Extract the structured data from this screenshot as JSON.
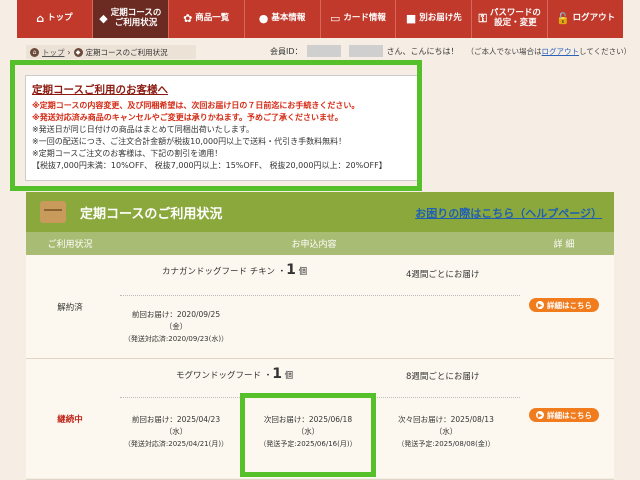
{
  "nav": [
    {
      "icon": "⌂",
      "label": "トップ",
      "active": false
    },
    {
      "icon": "◆",
      "label": "定期コースの\nご利用状況",
      "active": true
    },
    {
      "icon": "✿",
      "label": "商品一覧",
      "active": false
    },
    {
      "icon": "●",
      "label": "基本情報",
      "active": false
    },
    {
      "icon": "▭",
      "label": "カード情報",
      "active": false
    },
    {
      "icon": "■",
      "label": "別お届け先",
      "active": false
    },
    {
      "icon": "⚿",
      "label": "パスワードの\n設定・変更",
      "active": false
    },
    {
      "icon": "🔓",
      "label": "ログアウト",
      "active": false
    }
  ],
  "breadcrumb": {
    "top": "トップ",
    "current": "定期コースのご利用状況"
  },
  "member": {
    "id_label": "会員ID：",
    "greeting": "さん、こんにちは！",
    "note_prefix": "（ご本人でない場合は",
    "logout": "ログアウト",
    "note_suffix": "してください）"
  },
  "notice": {
    "title": "定期コースご利用のお客様へ",
    "red1": "※定期コースの内容変更、及び同梱希望は、次回お届け日の７日前迄にお手続きください。",
    "red2": "※発送対応済み商品のキャンセルやご変更は承りかねます。予めご了承くださいませ。",
    "b1": "※発送日が同じ日付けの商品はまとめて同梱出荷いたします。",
    "b2": "※一回の配送につき、ご注文合計金額が税抜10,000円以上で送料・代引き手数料無料！",
    "b3": "※定期コースご注文のお客様は、下記の割引を適用！",
    "b4": "【税抜7,000円未満：10%OFF、 税抜7,000円以上：15%OFF、 税抜20,000円以上：20%OFF】"
  },
  "panel": {
    "title": "定期コースのご利用状況",
    "help": "お困りの際はこちら（ヘルプページ）",
    "col_status": "ご利用状況",
    "col_content": "お申込内容",
    "col_detail": "詳 細"
  },
  "orders": [
    {
      "status": "解約済",
      "product": "カナガンドッグフード チキン",
      "qty": "1",
      "unit": "個",
      "frequency": "4週間ごとにお届け",
      "prev_label": "前回お届け：2020/09/25",
      "prev_day": "（金）",
      "prev_ship": "（発送対応済:2020/09/23(水)）",
      "detail": "詳細はこちら"
    },
    {
      "status": "継続中",
      "product": "モグワンドッグフード",
      "qty": "1",
      "unit": "個",
      "frequency": "8週間ごとにお届け",
      "prev_label": "前回お届け：2025/04/23",
      "prev_day": "（水）",
      "prev_ship": "（発送対応済:2025/04/21(月)）",
      "next_label": "次回お届け：2025/06/18",
      "next_day": "（水）",
      "next_ship": "（発送予定:2025/06/16(月)）",
      "after_label": "次々回お届け：2025/08/13",
      "after_day": "（水）",
      "after_ship": "（発送予定:2025/08/08(金)）",
      "detail": "詳細はこちら"
    }
  ],
  "colors": {
    "nav": "#c0392b",
    "nav_active": "#6b2a22",
    "panel_head": "#8aa83c",
    "highlight": "#55c029",
    "button": "#f07c1d"
  }
}
